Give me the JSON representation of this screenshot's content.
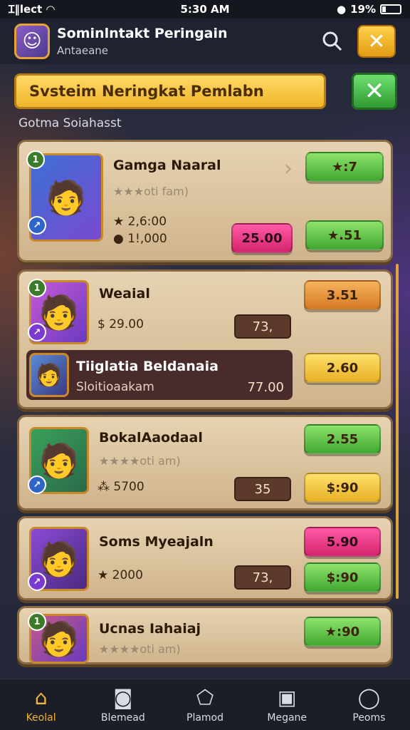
{
  "status_bar": {
    "left": "Ɪ‖lect",
    "time": "5:30 AM",
    "battery": "19%"
  },
  "app_bar": {
    "title": "Sominlntakt Peringain",
    "subtitle": "Antaeane"
  },
  "banner": {
    "text": "Svsteim Neringkat Pemlabn"
  },
  "section_label": "Gotma Soiahasst",
  "cards": [
    {
      "name": "Gamga Naaral",
      "subtitle": "★★★oti fam)",
      "stat1": "★ 2,6:00",
      "stat2": "● 1!,000",
      "btn_top": "★:7",
      "btn_pink": "25.00",
      "btn_bottom": "★.51"
    },
    {
      "name": "Weaial",
      "stat1": "$ 29.00",
      "pill": "73,",
      "btn_top": "3.51",
      "hl_name": "Tiiglatia Beldanaia",
      "hl_sub": "Sloitioaakam",
      "hl_val": "77.00",
      "btn_bottom": "2.60"
    },
    {
      "name": "BokalAaodaal",
      "subtitle": "★★★★oti am)",
      "stat1": "⁂ 5700",
      "pill": "35",
      "btn_top": "2.55",
      "btn_bottom": "$:90"
    },
    {
      "name": "Soms Myeajaln",
      "stat1": "★ 2000",
      "pill": "73,",
      "btn_top": "5.90",
      "btn_bottom": "$:90"
    },
    {
      "name": "Ucnas Iahaiaj",
      "subtitle": "★★★★oti am)",
      "btn_top": "★:90"
    }
  ],
  "nav": [
    {
      "label": "Keolal",
      "icon": "home-icon"
    },
    {
      "label": "Blemead",
      "icon": "camera-icon"
    },
    {
      "label": "Plamod",
      "icon": "pentagon-icon"
    },
    {
      "label": "Megane",
      "icon": "message-icon"
    },
    {
      "label": "Peoms",
      "icon": "profile-icon"
    }
  ],
  "colors": {
    "accent": "#f2b43c",
    "banner": "#f0b52a",
    "card": "#e7d3b2",
    "green": "#42a833"
  }
}
